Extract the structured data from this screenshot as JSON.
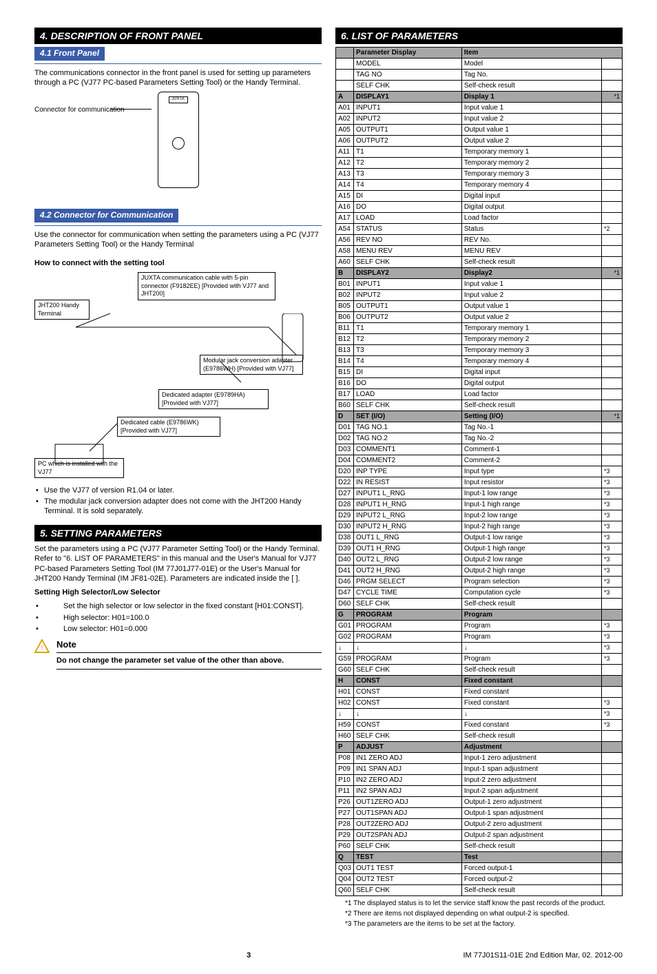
{
  "sec4": {
    "title": "4.   DESCRIPTION OF FRONT PANEL"
  },
  "sec4_1": {
    "title": "4.1  Front Panel",
    "body": "The communications connector in the front panel is used for setting up parameters through a PC (VJ77 PC-based Parameters Setting Tool) or the Handy Terminal.",
    "conn_label": "Connector for communication",
    "juxta": "JUXTA"
  },
  "sec4_2": {
    "title": "4.2  Connector for Communication",
    "body": "Use the connector for communication when setting the parameters using a PC (VJ77 Parameters Setting Tool) or the Handy Terminal",
    "howto": "How to connect with the setting tool",
    "jht_box": "JHT200\nHandy Terminal",
    "jcable_box": "JUXTA communication cable with 5-pin connector (F9182EE) [Provided with VJ77 and JHT200]",
    "modjack_box": "Modular jack conversion adapter (E9786WH) [Provided with VJ77]",
    "dedadapter_box": "Dedicated adapter (E9789HA) [Provided with VJ77]",
    "dedcable_box": "Dedicated cable (E9786WK) [Provided with VJ77]",
    "pc_box": "PC which is installed with the VJ77",
    "bullets": [
      "Use the VJ77 of version R1.04 or later.",
      "The modular jack conversion adapter does not come with the JHT200 Handy Terminal.  It is sold separately."
    ]
  },
  "sec5": {
    "title": "5.   SETTING PARAMETERS",
    "body": "Set the parameters using a PC (VJ77 Parameter Setting Tool) or the Handy Terminal. Refer to \"6. LIST OF PARAMETERS\" in this manual and the User's Manual for VJ77 PC-based Parameters Setting Tool (IM 77J01J77-01E) or the User's Manual for JHT200 Handy Terminal (IM JF81-02E). Parameters are indicated inside the [   ].",
    "sub_heading": "Setting High Selector/Low Selector",
    "items": [
      "Set the high selector or low selector in the fixed constant [H01:CONST].",
      "High selector: H01=100.0",
      "Low selector: H01=0.000"
    ],
    "note_title": "Note",
    "note_body": "Do not change the parameter set value of the other than above."
  },
  "sec6": {
    "title": "6.   LIST OF PARAMETERS"
  },
  "table_header": {
    "c1": "",
    "c2": "Parameter Display",
    "c3": "Item",
    "c4": ""
  },
  "rows": [
    {
      "t": "d",
      "code": "",
      "pd": "MODEL",
      "item": "Model",
      "n": ""
    },
    {
      "t": "d",
      "code": "",
      "pd": "TAG NO",
      "item": "Tag No.",
      "n": ""
    },
    {
      "t": "d",
      "code": "",
      "pd": "SELF CHK",
      "item": "Self-check result",
      "n": ""
    },
    {
      "t": "g",
      "code": "A",
      "pd": "DISPLAY1",
      "item": "Display 1",
      "n": "*1"
    },
    {
      "t": "d",
      "code": "A01",
      "pd": "INPUT1",
      "item": "Input value 1",
      "n": ""
    },
    {
      "t": "d",
      "code": "A02",
      "pd": "INPUT2",
      "item": "Input value 2",
      "n": ""
    },
    {
      "t": "d",
      "code": "A05",
      "pd": "OUTPUT1",
      "item": "Output value 1",
      "n": ""
    },
    {
      "t": "d",
      "code": "A06",
      "pd": "OUTPUT2",
      "item": "Output value 2",
      "n": ""
    },
    {
      "t": "d",
      "code": "A11",
      "pd": "T1",
      "item": "Temporary memory 1",
      "n": ""
    },
    {
      "t": "d",
      "code": "A12",
      "pd": "T2",
      "item": "Temporary memory 2",
      "n": ""
    },
    {
      "t": "d",
      "code": "A13",
      "pd": "T3",
      "item": "Temporary memory 3",
      "n": ""
    },
    {
      "t": "d",
      "code": "A14",
      "pd": "T4",
      "item": "Temporary memory 4",
      "n": ""
    },
    {
      "t": "d",
      "code": "A15",
      "pd": "DI",
      "item": "Digital input",
      "n": ""
    },
    {
      "t": "d",
      "code": "A16",
      "pd": "DO",
      "item": "Digital output",
      "n": ""
    },
    {
      "t": "d",
      "code": "A17",
      "pd": "LOAD",
      "item": "Load factor",
      "n": ""
    },
    {
      "t": "d",
      "code": "A54",
      "pd": "STATUS",
      "item": "Status",
      "n": "*2"
    },
    {
      "t": "d",
      "code": "A56",
      "pd": "REV NO",
      "item": "REV No.",
      "n": ""
    },
    {
      "t": "d",
      "code": "A58",
      "pd": "MENU REV",
      "item": "MENU REV",
      "n": ""
    },
    {
      "t": "d",
      "code": "A60",
      "pd": "SELF CHK",
      "item": "Self-check result",
      "n": ""
    },
    {
      "t": "g",
      "code": "B",
      "pd": "DISPLAY2",
      "item": "Display2",
      "n": "*1"
    },
    {
      "t": "d",
      "code": "B01",
      "pd": "INPUT1",
      "item": "Input value 1",
      "n": ""
    },
    {
      "t": "d",
      "code": "B02",
      "pd": "INPUT2",
      "item": "Input value 2",
      "n": ""
    },
    {
      "t": "d",
      "code": "B05",
      "pd": "OUTPUT1",
      "item": "Output value 1",
      "n": ""
    },
    {
      "t": "d",
      "code": "B06",
      "pd": "OUTPUT2",
      "item": "Output value 2",
      "n": ""
    },
    {
      "t": "d",
      "code": "B11",
      "pd": "T1",
      "item": "Temporary memory 1",
      "n": ""
    },
    {
      "t": "d",
      "code": "B12",
      "pd": "T2",
      "item": "Temporary memory 2",
      "n": ""
    },
    {
      "t": "d",
      "code": "B13",
      "pd": "T3",
      "item": "Temporary memory 3",
      "n": ""
    },
    {
      "t": "d",
      "code": "B14",
      "pd": "T4",
      "item": "Temporary memory 4",
      "n": ""
    },
    {
      "t": "d",
      "code": "B15",
      "pd": "DI",
      "item": "Digital input",
      "n": ""
    },
    {
      "t": "d",
      "code": "B16",
      "pd": "DO",
      "item": "Digital output",
      "n": ""
    },
    {
      "t": "d",
      "code": "B17",
      "pd": "LOAD",
      "item": "Load factor",
      "n": ""
    },
    {
      "t": "d",
      "code": "B60",
      "pd": "SELF CHK",
      "item": "Self-check result",
      "n": ""
    },
    {
      "t": "g",
      "code": "D",
      "pd": "SET (I/O)",
      "item": "Setting (I/O)",
      "n": "*1"
    },
    {
      "t": "d",
      "code": "D01",
      "pd": "TAG NO.1",
      "item": "Tag No.-1",
      "n": ""
    },
    {
      "t": "d",
      "code": "D02",
      "pd": "TAG NO.2",
      "item": "Tag No.-2",
      "n": ""
    },
    {
      "t": "d",
      "code": "D03",
      "pd": "COMMENT1",
      "item": "Comment-1",
      "n": ""
    },
    {
      "t": "d",
      "code": "D04",
      "pd": "COMMENT2",
      "item": "Comment-2",
      "n": ""
    },
    {
      "t": "d",
      "code": "D20",
      "pd": "INP TYPE",
      "item": "Input type",
      "n": "*3"
    },
    {
      "t": "d",
      "code": "D22",
      "pd": "IN RESIST",
      "item": "Input resistor",
      "n": "*3"
    },
    {
      "t": "d",
      "code": "D27",
      "pd": "INPUT1 L_RNG",
      "item": "Input-1 low range",
      "n": "*3"
    },
    {
      "t": "d",
      "code": "D28",
      "pd": "INPUT1 H_RNG",
      "item": "Input-1 high range",
      "n": "*3"
    },
    {
      "t": "d",
      "code": "D29",
      "pd": "INPUT2 L_RNG",
      "item": "Input-2 low range",
      "n": "*3"
    },
    {
      "t": "d",
      "code": "D30",
      "pd": "INPUT2 H_RNG",
      "item": "Input-2 high range",
      "n": "*3"
    },
    {
      "t": "d",
      "code": "D38",
      "pd": "OUT1 L_RNG",
      "item": "Output-1 low range",
      "n": "*3"
    },
    {
      "t": "d",
      "code": "D39",
      "pd": "OUT1 H_RNG",
      "item": "Output-1 high range",
      "n": "*3"
    },
    {
      "t": "d",
      "code": "D40",
      "pd": "OUT2 L_RNG",
      "item": "Output-2 low range",
      "n": "*3"
    },
    {
      "t": "d",
      "code": "D41",
      "pd": "OUT2 H_RNG",
      "item": "Output-2 high range",
      "n": "*3"
    },
    {
      "t": "d",
      "code": "D46",
      "pd": "PRGM SELECT",
      "item": "Program selection",
      "n": "*3"
    },
    {
      "t": "d",
      "code": "D47",
      "pd": "CYCLE TIME",
      "item": "Computation cycle",
      "n": "*3"
    },
    {
      "t": "d",
      "code": "D60",
      "pd": "SELF CHK",
      "item": "Self-check result",
      "n": ""
    },
    {
      "t": "g",
      "code": "G",
      "pd": "PROGRAM",
      "item": "Program",
      "n": ""
    },
    {
      "t": "d",
      "code": "G01",
      "pd": "PROGRAM",
      "item": "Program",
      "n": "*3"
    },
    {
      "t": "d",
      "code": "G02",
      "pd": "PROGRAM",
      "item": "Program",
      "n": "*3"
    },
    {
      "t": "d",
      "code": "↓",
      "pd": "↓",
      "item": "↓",
      "n": "*3"
    },
    {
      "t": "d",
      "code": "G59",
      "pd": "PROGRAM",
      "item": "Program",
      "n": "*3"
    },
    {
      "t": "d",
      "code": "G60",
      "pd": "SELF CHK",
      "item": "Self-check result",
      "n": ""
    },
    {
      "t": "g",
      "code": "H",
      "pd": "CONST",
      "item": "Fixed constant",
      "n": ""
    },
    {
      "t": "d",
      "code": "H01",
      "pd": "CONST",
      "item": "Fixed constant",
      "n": ""
    },
    {
      "t": "d",
      "code": "H02",
      "pd": "CONST",
      "item": "Fixed constant",
      "n": "*3"
    },
    {
      "t": "d",
      "code": "↓",
      "pd": "↓",
      "item": "↓",
      "n": "*3"
    },
    {
      "t": "d",
      "code": "H59",
      "pd": "CONST",
      "item": "Fixed constant",
      "n": "*3"
    },
    {
      "t": "d",
      "code": "H60",
      "pd": "SELF CHK",
      "item": "Self-check result",
      "n": ""
    },
    {
      "t": "g",
      "code": "P",
      "pd": "ADJUST",
      "item": "Adjustment",
      "n": ""
    },
    {
      "t": "d",
      "code": "P08",
      "pd": "IN1 ZERO ADJ",
      "item": "Input-1 zero adjustment",
      "n": ""
    },
    {
      "t": "d",
      "code": "P09",
      "pd": "IN1 SPAN ADJ",
      "item": "Input-1 span adjustment",
      "n": ""
    },
    {
      "t": "d",
      "code": "P10",
      "pd": "IN2 ZERO ADJ",
      "item": "Input-2 zero adjustment",
      "n": ""
    },
    {
      "t": "d",
      "code": "P11",
      "pd": "IN2 SPAN ADJ",
      "item": "Input-2 span adjustment",
      "n": ""
    },
    {
      "t": "d",
      "code": "P26",
      "pd": "OUT1ZERO ADJ",
      "item": "Output-1 zero adjustment",
      "n": ""
    },
    {
      "t": "d",
      "code": "P27",
      "pd": "OUT1SPAN ADJ",
      "item": "Output-1 span adjustment",
      "n": ""
    },
    {
      "t": "d",
      "code": "P28",
      "pd": "OUT2ZERO ADJ",
      "item": "Output-2 zero adjustment",
      "n": ""
    },
    {
      "t": "d",
      "code": "P29",
      "pd": "OUT2SPAN ADJ",
      "item": "Output-2 span adjustment",
      "n": ""
    },
    {
      "t": "d",
      "code": "P60",
      "pd": "SELF CHK",
      "item": "Self-check result",
      "n": ""
    },
    {
      "t": "g",
      "code": "Q",
      "pd": "TEST",
      "item": "Test",
      "n": ""
    },
    {
      "t": "d",
      "code": "Q03",
      "pd": "OUT1 TEST",
      "item": "Forced output-1",
      "n": ""
    },
    {
      "t": "d",
      "code": "Q04",
      "pd": "OUT2 TEST",
      "item": "Forced output-2",
      "n": ""
    },
    {
      "t": "d",
      "code": "Q60",
      "pd": "SELF  CHK",
      "item": "Self-check result",
      "n": ""
    }
  ],
  "footnotes": [
    "*1 The displayed status is to let the service staff know the past records of the product.",
    "*2 There are items not displayed depending on what output-2 is specified.",
    "*3 The parameters are the items to be set at the factory."
  ],
  "footer": {
    "page": "3",
    "doc": "IM 77J01S11-01E   2nd Edition   Mar, 02. 2012-00"
  }
}
